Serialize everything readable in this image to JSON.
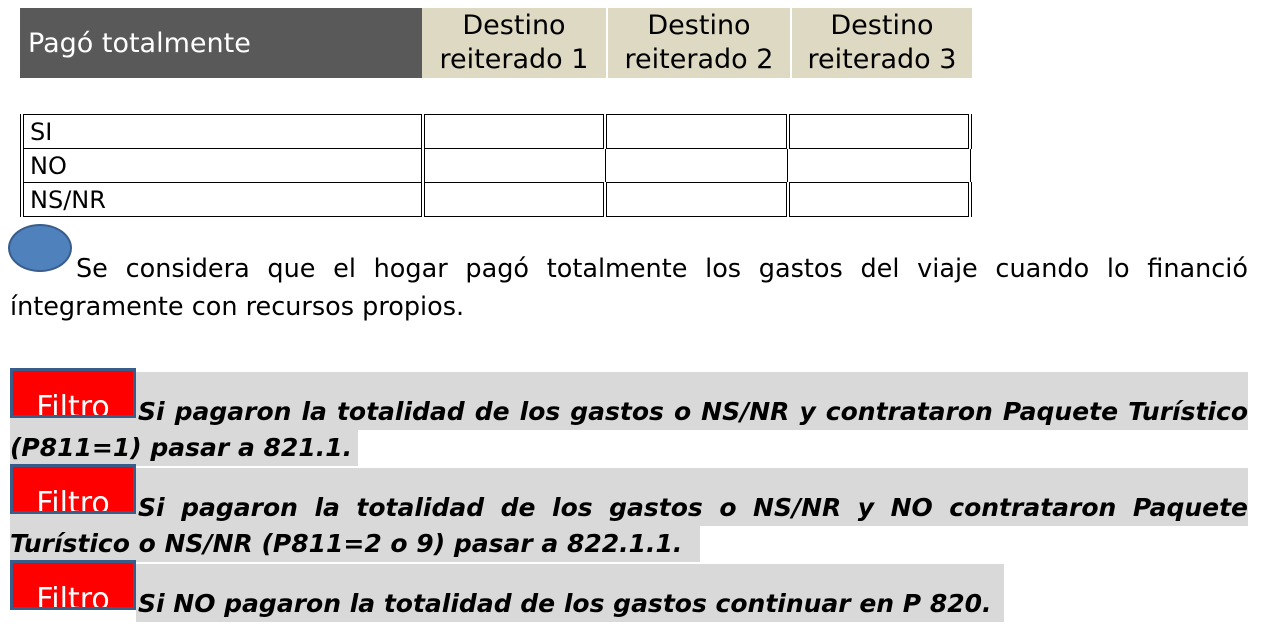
{
  "header": {
    "title": "Pagó totalmente",
    "columns": [
      "Destino\nreiterado 1",
      "Destino\nreiterado 2",
      "Destino\nreiterado 3"
    ]
  },
  "grid": {
    "rows": [
      {
        "label": "SI"
      },
      {
        "label": "NO"
      },
      {
        "label": "NS/NR"
      }
    ]
  },
  "note": {
    "text": "Se considera que el hogar pagó totalmente los gastos del viaje cuando lo financió íntegramente con recursos propios.",
    "bubble_color": "#4f81bd"
  },
  "filters": {
    "badge_label": "Filtro",
    "badge_color": "#ff0000",
    "items": [
      {
        "text": "Si pagaron la totalidad de los gastos o NS/NR y contrataron Paquete Turístico (P811=1) pasar a 821.1."
      },
      {
        "text": "Si pagaron la totalidad de los gastos o NS/NR y NO contrataron Paquete Turístico o NS/NR (P811=2 o 9) pasar a 822.1.1."
      },
      {
        "text": "Si NO pagaron la totalidad de los gastos continuar en P 820."
      }
    ]
  }
}
